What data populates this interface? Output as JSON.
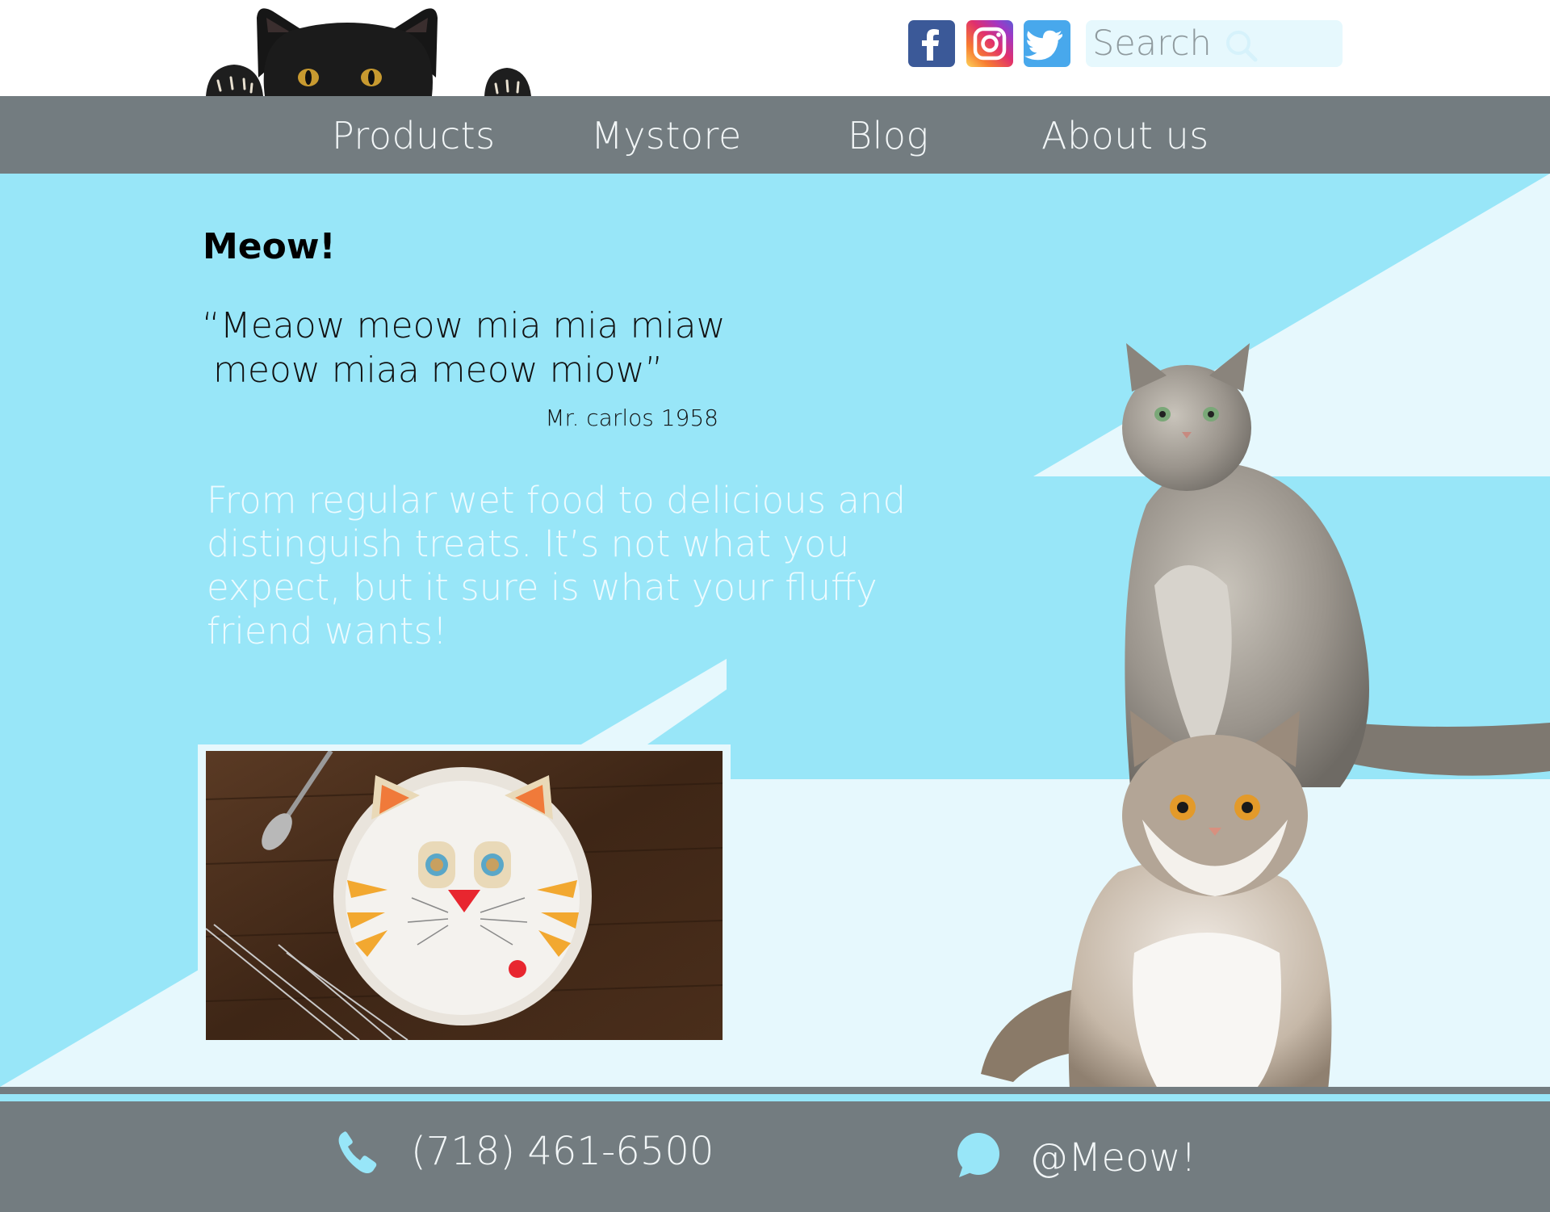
{
  "header": {
    "social": [
      {
        "name": "Facebook",
        "icon": "facebook-icon",
        "color": "#3b5998"
      },
      {
        "name": "Instagram",
        "icon": "instagram-icon",
        "color": "#e1306c"
      },
      {
        "name": "Twitter",
        "icon": "twitter-icon",
        "color": "#48a8ec"
      }
    ],
    "search": {
      "placeholder": "Search",
      "value": "",
      "icon": "search-icon"
    }
  },
  "nav": {
    "items": [
      {
        "label": "Products"
      },
      {
        "label": "Mystore"
      },
      {
        "label": "Blog"
      },
      {
        "label": "About us"
      }
    ]
  },
  "main": {
    "heading": "Meow!",
    "quote": {
      "text": "“Meaow meow mia mia miaw\n meow miaa meow miow”",
      "author": "Mr. carlos 1958"
    },
    "intro": "From regular wet food to delicious and distinguish treats. It’s not what you expect, but it sure is what your fluffy friend wants!"
  },
  "footer": {
    "phone": "(718) 461-6500",
    "handle": "@Meow!",
    "phone_icon": "phone-icon",
    "chat_icon": "chat-bubble-icon"
  },
  "colors": {
    "nav_bg": "#737c80",
    "sky_blue": "#98e6f8",
    "pale_blue": "#e6f8fd",
    "nav_text": "#f2f6f7",
    "intro_text": "#ecfbff"
  }
}
